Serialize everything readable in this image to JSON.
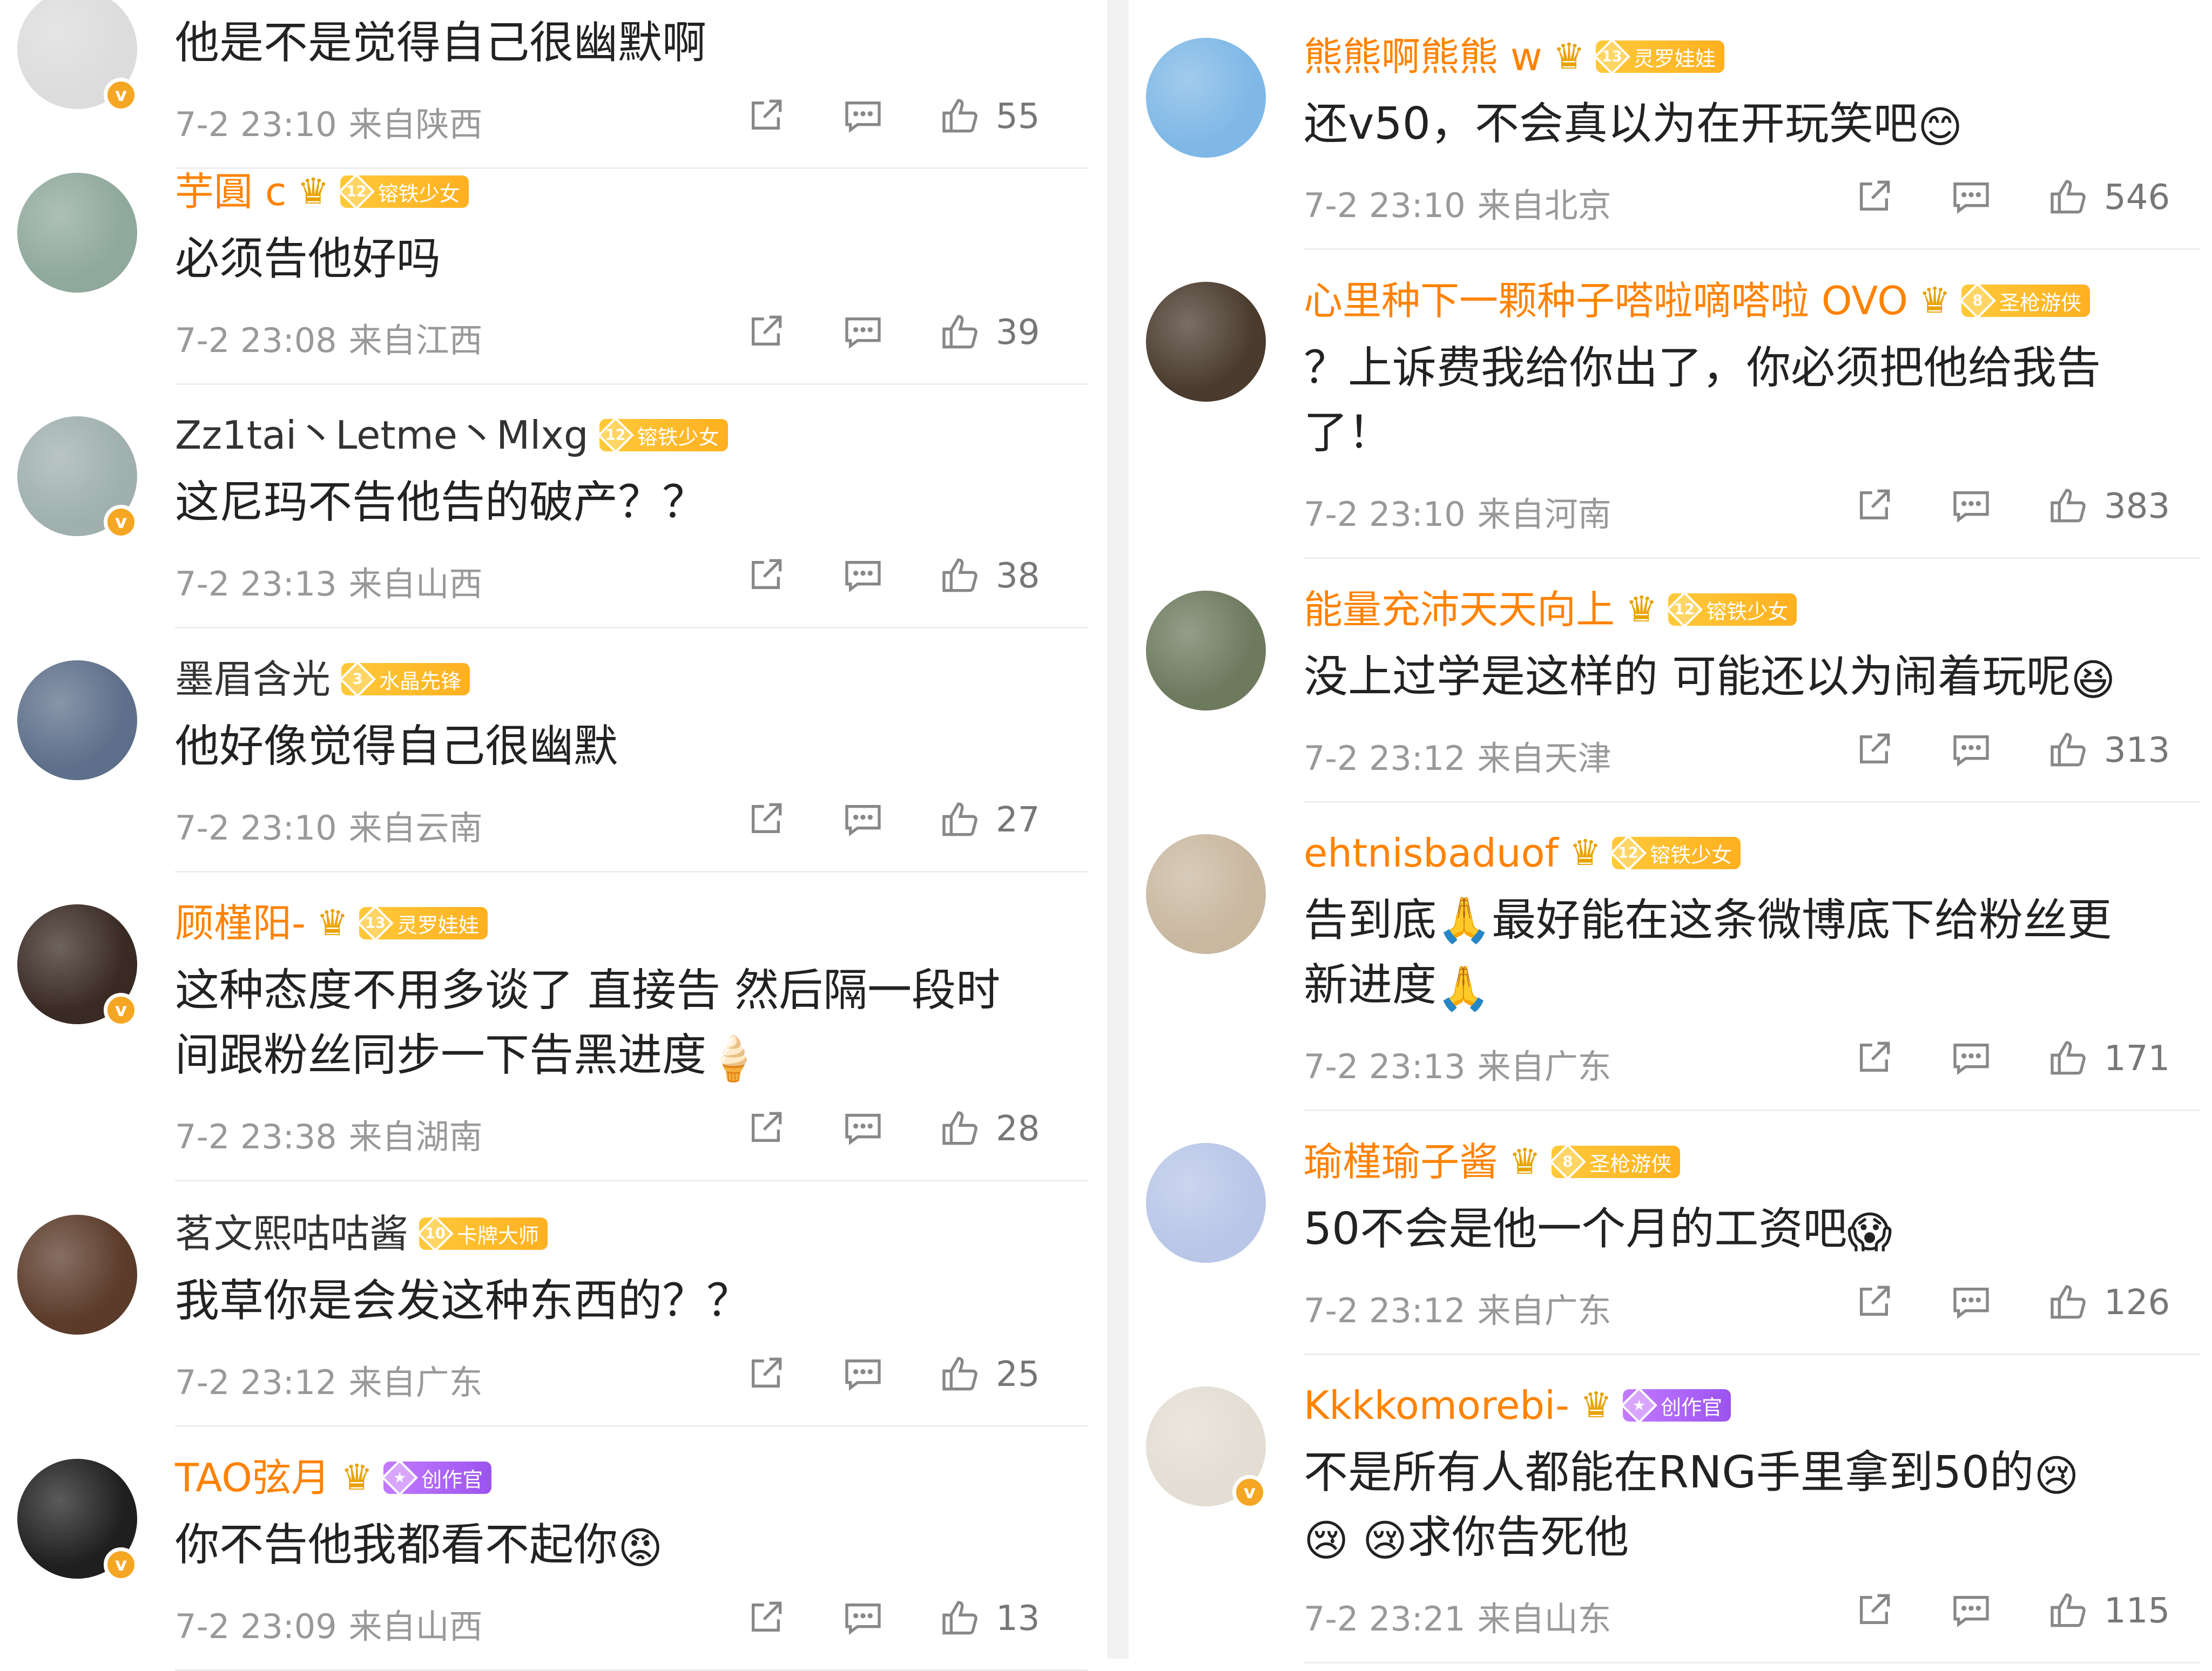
{
  "left": [
    {
      "name": "",
      "vip": false,
      "verified": true,
      "text": [
        "他是不是觉得自己很幽默啊"
      ],
      "time": "7-2 23:10",
      "location": "来自陕西",
      "likes": "55",
      "avatar_color": "#dcdcdc"
    },
    {
      "name": "芋圓 c",
      "vip": true,
      "crown": true,
      "rank_level": "12",
      "rank_title": "镕铁少女",
      "verified": false,
      "text": [
        "必须告他好吗"
      ],
      "time": "7-2 23:08",
      "location": "来自江西",
      "likes": "39",
      "avatar_color": "#8fa99c"
    },
    {
      "name": "Zz1tai丶Letme丶Mlxg",
      "vip": false,
      "crown": false,
      "rank_level": "12",
      "rank_title": "镕铁少女",
      "verified": true,
      "text": [
        "这尼玛不告他告的破产？？"
      ],
      "time": "7-2 23:13",
      "location": "来自山西",
      "likes": "38",
      "avatar_color": "#9fb0ae"
    },
    {
      "name": "墨眉含光",
      "vip": false,
      "crown": false,
      "rank_level": "3",
      "rank_title": "水晶先锋",
      "verified": false,
      "text": [
        "他好像觉得自己很幽默"
      ],
      "time": "7-2 23:10",
      "location": "来自云南",
      "likes": "27",
      "avatar_color": "#5d6f8a"
    },
    {
      "name": "顾槿阳-",
      "vip": true,
      "crown": true,
      "rank_level": "13",
      "rank_title": "灵罗娃娃",
      "verified": true,
      "text": [
        "这种态度不用多谈了 直接告 然后隔一段时",
        "间跟粉丝同步一下告黑进度"
      ],
      "emoji_end": "🍦",
      "time": "7-2 23:38",
      "location": "来自湖南",
      "likes": "28",
      "avatar_color": "#3a2a24"
    },
    {
      "name": "茗文熙咕咕酱",
      "vip": false,
      "crown": false,
      "rank_level": "10",
      "rank_title": "卡牌大师",
      "verified": false,
      "text": [
        "我草你是会发这种东西的？？"
      ],
      "time": "7-2 23:12",
      "location": "来自广东",
      "likes": "25",
      "avatar_color": "#5b3b2a"
    },
    {
      "name": "TAO弦月",
      "vip": true,
      "crown": true,
      "rank_title": "创作官",
      "rank_purple": true,
      "verified": true,
      "text": [
        "你不告他我都看不起你"
      ],
      "emoji_end": "😡",
      "time": "7-2 23:09",
      "location": "来自山西",
      "likes": "13",
      "avatar_color": "#1f1f1f"
    }
  ],
  "right": [
    {
      "name": "熊熊啊熊熊 w",
      "vip": true,
      "crown": true,
      "rank_level": "13",
      "rank_title": "灵罗娃娃",
      "verified": false,
      "text": [
        "还v50，不会真以为在开玩笑吧"
      ],
      "emoji_end": "😊",
      "time": "7-2 23:10",
      "location": "来自北京",
      "likes": "546",
      "avatar_color": "#7fb8e6"
    },
    {
      "name": "心里种下一颗种子嗒啦嘀嗒啦 OVO",
      "vip": true,
      "crown": true,
      "rank_level": "8",
      "rank_title": "圣枪游侠",
      "verified": false,
      "text": [
        "？上诉费我给你出了，你必须把他给我告",
        "了！"
      ],
      "time": "7-2 23:10",
      "location": "来自河南",
      "likes": "383",
      "avatar_color": "#4a3b2e"
    },
    {
      "name": "能量充沛天天向上",
      "vip": true,
      "crown": true,
      "rank_level": "12",
      "rank_title": "镕铁少女",
      "verified": false,
      "text": [
        "没上过学是这样的 可能还以为闹着玩呢"
      ],
      "emoji_end": "😆",
      "time": "7-2 23:12",
      "location": "来自天津",
      "likes": "313",
      "avatar_color": "#6d7a5e"
    },
    {
      "name": "ehtnisbaduof",
      "vip": true,
      "crown": true,
      "rank_level": "12",
      "rank_title": "镕铁少女",
      "verified": false,
      "text": [
        "告到底🙏最好能在这条微博底下给粉丝更",
        "新进度"
      ],
      "emoji_end": "🙏",
      "time": "7-2 23:13",
      "location": "来自广东",
      "likes": "171",
      "avatar_color": "#c9b8a0"
    },
    {
      "name": "瑜槿瑜子酱",
      "vip": true,
      "crown": true,
      "rank_level": "8",
      "rank_title": "圣枪游侠",
      "verified": false,
      "text": [
        "50不会是他一个月的工资吧"
      ],
      "emoji_end": "😱",
      "time": "7-2 23:12",
      "location": "来自广东",
      "likes": "126",
      "avatar_color": "#b9c6e8"
    },
    {
      "name": "Kkkkomorebi-",
      "vip": true,
      "crown": true,
      "rank_title": "创作官",
      "rank_purple": true,
      "verified": true,
      "text": [
        "不是所有人都能在RNG手里拿到50的",
        "求你告死他"
      ],
      "emoji_mid": "😢",
      "emoji_pre2": "😢 😢",
      "time": "7-2 23:21",
      "location": "来自山东",
      "likes": "115",
      "avatar_color": "#e3ddd3"
    }
  ]
}
